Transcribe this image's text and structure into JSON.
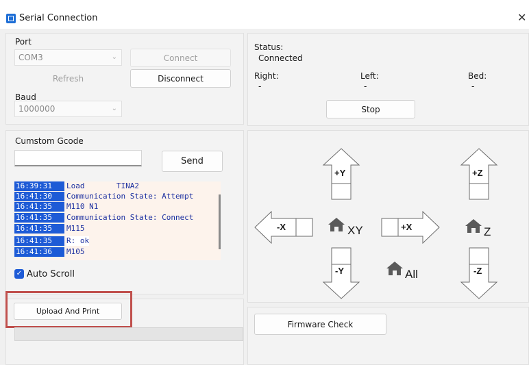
{
  "window": {
    "title": "Serial Connection",
    "close_glyph": "✕"
  },
  "port": {
    "label": "Port",
    "selected": "COM3",
    "connect_label": "Connect",
    "refresh_label": "Refresh",
    "disconnect_label": "Disconnect",
    "baud_label": "Baud",
    "baud_selected": "1000000"
  },
  "status": {
    "label": "Status:",
    "value": "Connected",
    "right_label": "Right:",
    "right_value": "-",
    "left_label": "Left:",
    "left_value": "-",
    "bed_label": "Bed:",
    "bed_value": "-",
    "stop_label": "Stop"
  },
  "gcode": {
    "label": "Cumstom Gcode",
    "input_value": "",
    "send_label": "Send",
    "log": [
      {
        "time": "16:39:31",
        "message": "Load       TINA2"
      },
      {
        "time": "16:41:30",
        "message": "Communication State: Attempt"
      },
      {
        "time": "16:41:35",
        "message": "M110 N1"
      },
      {
        "time": "16:41:35",
        "message": "Communication State: Connect"
      },
      {
        "time": "16:41:35",
        "message": "M115"
      },
      {
        "time": "16:41:35",
        "message": "R: ok"
      },
      {
        "time": "16:41:36",
        "message": "M105"
      }
    ],
    "auto_scroll_label": "Auto Scroll",
    "auto_scroll_checked": true
  },
  "upload": {
    "label": "Upload And Print",
    "highlight_color": "#c0504d"
  },
  "jog": {
    "plus_y": "+Y",
    "minus_y": "-Y",
    "plus_x": "+X",
    "minus_x": "-X",
    "plus_z": "+Z",
    "minus_z": "-Z",
    "home_xy": "XY",
    "home_z": "Z",
    "home_all": "All",
    "home_icon": "home-icon"
  },
  "firmware": {
    "label": "Firmware Check"
  },
  "colors": {
    "accent": "#1e5bd6",
    "log_text": "#1c2fa0",
    "log_bg": "#fdf3ec"
  }
}
